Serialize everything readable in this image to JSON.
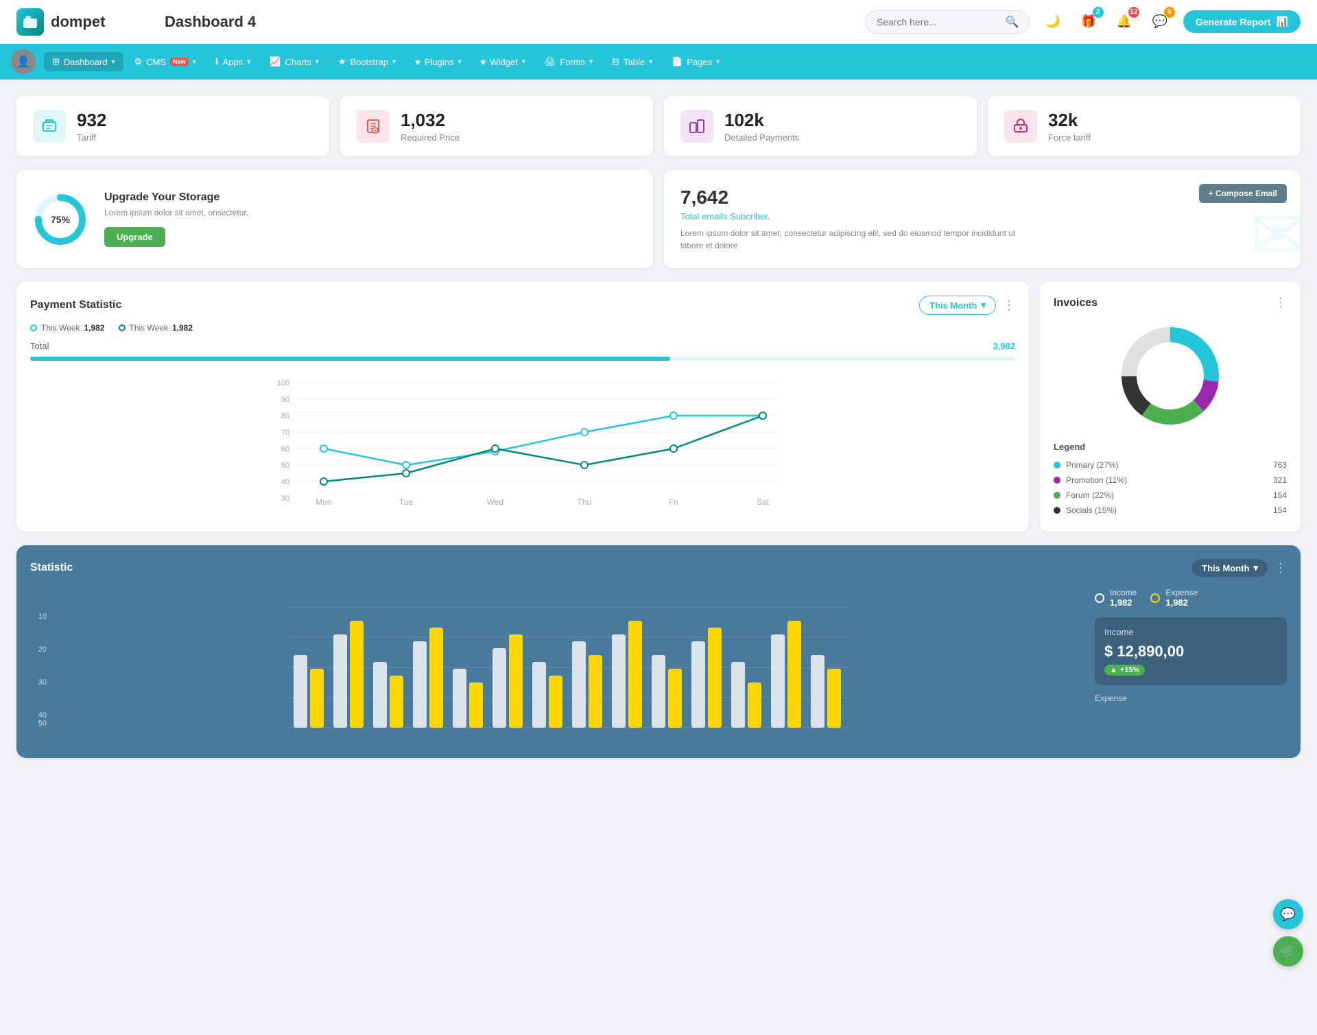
{
  "header": {
    "logo_text": "dompet",
    "page_title": "Dashboard 4",
    "search_placeholder": "Search here...",
    "generate_btn": "Generate Report",
    "icons": {
      "gift_badge": "2",
      "bell_badge": "12",
      "chat_badge": "5"
    }
  },
  "nav": {
    "items": [
      {
        "label": "Dashboard",
        "active": true,
        "has_arrow": true
      },
      {
        "label": "CMS",
        "badge": "New",
        "has_arrow": true
      },
      {
        "label": "Apps",
        "has_arrow": true
      },
      {
        "label": "Charts",
        "has_arrow": true
      },
      {
        "label": "Bootstrap",
        "has_arrow": true
      },
      {
        "label": "Plugins",
        "has_arrow": true
      },
      {
        "label": "Widget",
        "has_arrow": true
      },
      {
        "label": "Forms",
        "has_arrow": true
      },
      {
        "label": "Table",
        "has_arrow": true
      },
      {
        "label": "Pages",
        "has_arrow": true
      }
    ]
  },
  "stat_cards": [
    {
      "number": "932",
      "label": "Tariff",
      "icon_type": "teal"
    },
    {
      "number": "1,032",
      "label": "Required Price",
      "icon_type": "red"
    },
    {
      "number": "102k",
      "label": "Detailed Payments",
      "icon_type": "purple"
    },
    {
      "number": "32k",
      "label": "Force tariff",
      "icon_type": "pink"
    }
  ],
  "storage": {
    "percentage": "75%",
    "title": "Upgrade Your Storage",
    "description": "Lorem ipsum dolor sit amet, onsectetur.",
    "btn_label": "Upgrade"
  },
  "email": {
    "count": "7,642",
    "subtitle": "Total emails Subcriber.",
    "description": "Lorem ipsum dolor sit amet, consectetur adipiscing elit, sed do eiusmod tempor incididunt ut labore et dolore",
    "compose_btn": "+ Compose Email"
  },
  "payment_statistic": {
    "title": "Payment Statistic",
    "this_month_btn": "This Month",
    "legend": [
      {
        "label": "This Week",
        "value": "1,982",
        "color": "teal"
      },
      {
        "label": "This Week",
        "value": "1,982",
        "color": "teal2"
      }
    ],
    "total_label": "Total",
    "total_value": "3,982",
    "x_labels": [
      "Mon",
      "Tue",
      "Wed",
      "Thu",
      "Fri",
      "Sat"
    ],
    "y_labels": [
      "100",
      "90",
      "80",
      "70",
      "60",
      "50",
      "40",
      "30"
    ]
  },
  "invoices": {
    "title": "Invoices",
    "legend": [
      {
        "label": "Primary (27%)",
        "color": "#26c6da",
        "value": "763"
      },
      {
        "label": "Promotion (11%)",
        "color": "#9c27b0",
        "value": "321"
      },
      {
        "label": "Forum (22%)",
        "color": "#4caf50",
        "value": "154"
      },
      {
        "label": "Socials (15%)",
        "color": "#333",
        "value": "154"
      }
    ],
    "legend_title": "Legend"
  },
  "statistic": {
    "title": "Statistic",
    "this_month_btn": "This Month",
    "income_label": "Income",
    "income_value": "1,982",
    "expense_label": "Expense",
    "expense_value": "1,982",
    "income_box": {
      "title": "Income",
      "amount": "$ 12,890,00",
      "badge": "+15%"
    },
    "y_labels": [
      "50",
      "40",
      "30",
      "20",
      "10"
    ],
    "month_btn": "Month"
  }
}
